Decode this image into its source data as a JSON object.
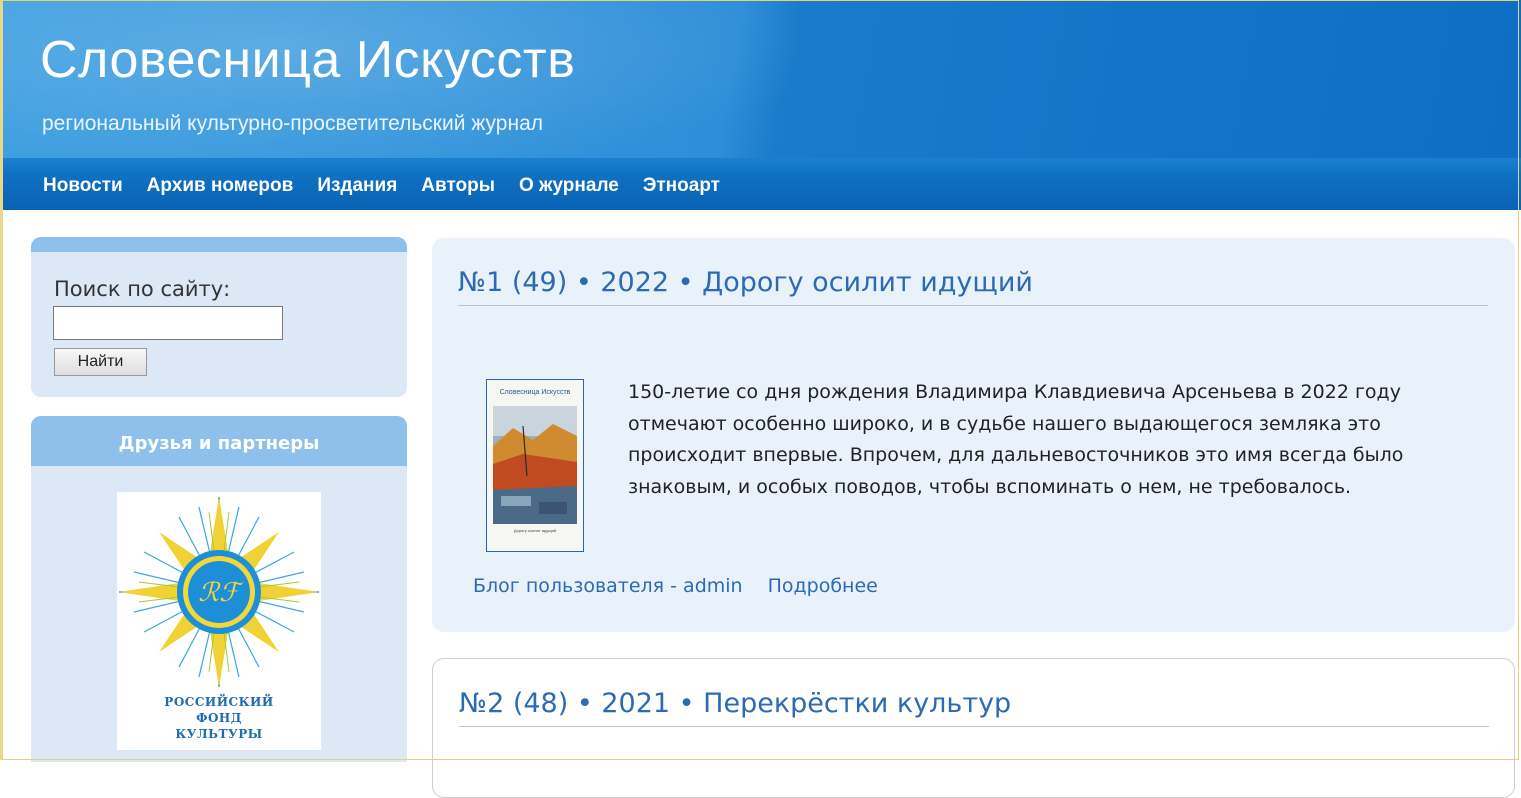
{
  "header": {
    "site_title": "Словесница Искусств",
    "slogan": "региональный культурно-просветительский журнал"
  },
  "nav": {
    "items": [
      "Новости",
      "Архив номеров",
      "Издания",
      "Авторы",
      "О журнале",
      "Этноарт"
    ]
  },
  "sidebar": {
    "search": {
      "label": "Поиск по сайту:",
      "value": "",
      "button": "Найти"
    },
    "partners": {
      "title": "Друзья и партнеры",
      "logo_text": [
        "РОССИЙСКИЙ",
        "ФОНД",
        "КУЛЬТУРЫ"
      ]
    }
  },
  "posts": [
    {
      "title": "№1 (49) • 2022 • Дорогу осилит идущий",
      "cover_title": "Словесница Искусств",
      "cover_subtitle": "Дорогу осилит идущий",
      "teaser": "150-летие со дня рождения Владимира Клавдиевича Арсеньева в 2022 году отмечают особенно широко, и в судьбе нашего выдающегося земляка это происходит впервые. Впрочем, для дальневосточников это имя всегда было знаковым, и особых поводов, чтобы вспоминать о нем, не требовалось.",
      "links": [
        "Блог пользователя - admin",
        "Подробнее"
      ]
    },
    {
      "title": "№2 (48) • 2021 • Перекрёстки культур"
    }
  ],
  "colors": {
    "header_blue": "#1a7acb",
    "nav_blue": "#0f70c2",
    "link_blue": "#2c6ab4",
    "sidebar_bg": "#dce8f5",
    "sidebar_head": "#8fc0ec"
  }
}
